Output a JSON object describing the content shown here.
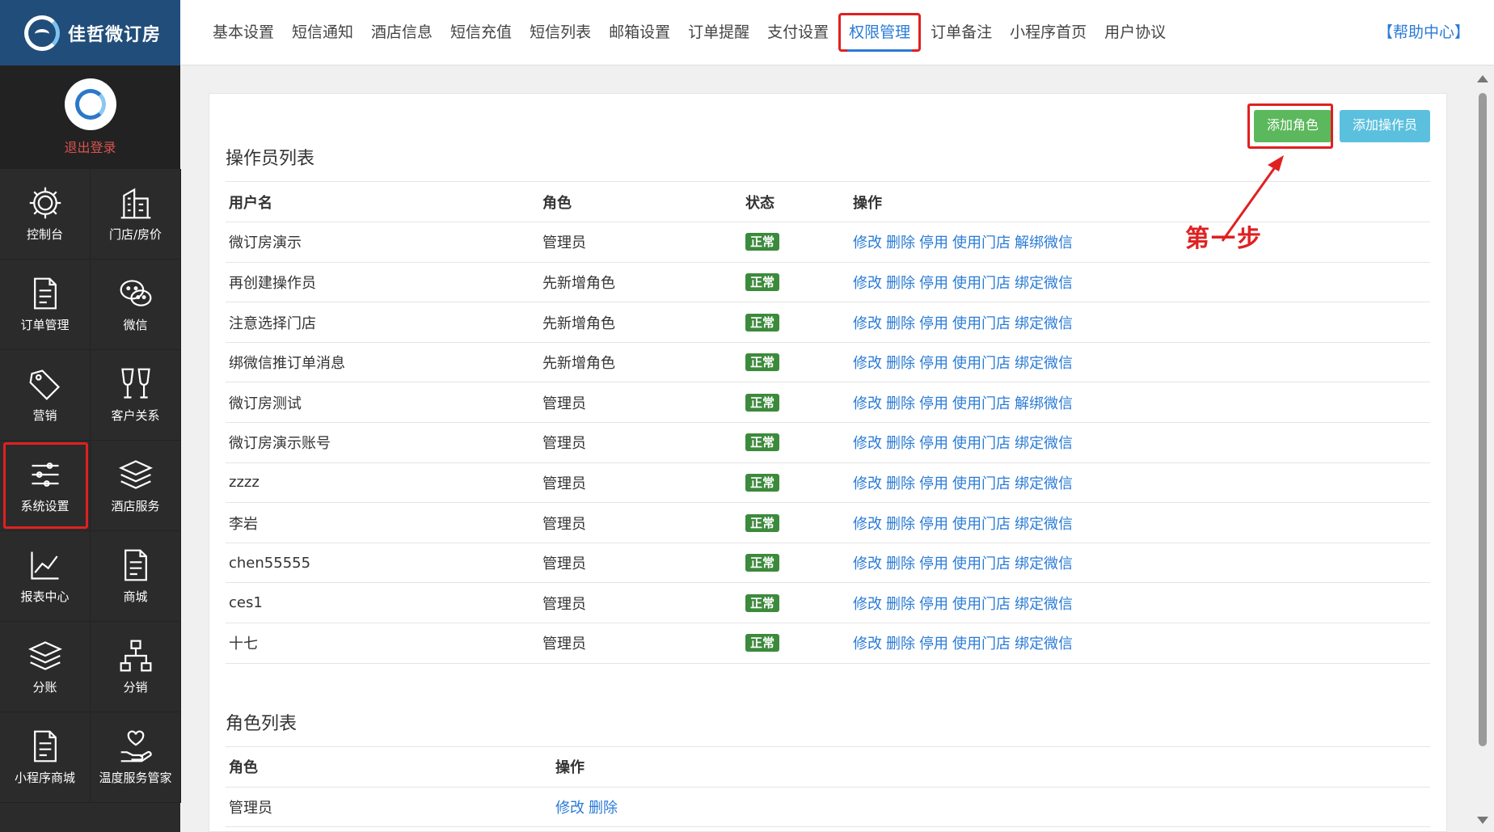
{
  "app": {
    "brand": "佳哲微订房",
    "logout": "退出登录"
  },
  "sidebar": {
    "items": [
      {
        "label": "控制台",
        "icon": "gear-icon"
      },
      {
        "label": "门店/房价",
        "icon": "building-icon"
      },
      {
        "label": "订单管理",
        "icon": "document-icon"
      },
      {
        "label": "微信",
        "icon": "wechat-icon"
      },
      {
        "label": "营销",
        "icon": "tag-icon"
      },
      {
        "label": "客户关系",
        "icon": "glasses-icon"
      },
      {
        "label": "系统设置",
        "icon": "sliders-icon"
      },
      {
        "label": "酒店服务",
        "icon": "layers-icon"
      },
      {
        "label": "报表中心",
        "icon": "chart-line-icon"
      },
      {
        "label": "商城",
        "icon": "document-icon"
      },
      {
        "label": "分账",
        "icon": "layers-icon"
      },
      {
        "label": "分销",
        "icon": "network-icon"
      },
      {
        "label": "小程序商城",
        "icon": "document-icon"
      },
      {
        "label": "温度服务管家",
        "icon": "heart-hand-icon"
      }
    ]
  },
  "tabs": [
    "基本设置",
    "短信通知",
    "酒店信息",
    "短信充值",
    "短信列表",
    "邮箱设置",
    "订单提醒",
    "支付设置",
    "权限管理",
    "订单备注",
    "小程序首页",
    "用户协议"
  ],
  "help": "【帮助中心】",
  "buttons": {
    "add_role": "添加角色",
    "add_operator": "添加操作员"
  },
  "annotation": {
    "step": "第一步"
  },
  "operators": {
    "title": "操作员列表",
    "headers": [
      "用户名",
      "角色",
      "状态",
      "操作"
    ],
    "rows": [
      {
        "name": "微订房演示",
        "role": "管理员",
        "status": "正常",
        "ops": [
          "修改",
          "删除",
          "停用",
          "使用门店",
          "解绑微信"
        ]
      },
      {
        "name": "再创建操作员",
        "role": "先新增角色",
        "status": "正常",
        "ops": [
          "修改",
          "删除",
          "停用",
          "使用门店",
          "绑定微信"
        ]
      },
      {
        "name": "注意选择门店",
        "role": "先新增角色",
        "status": "正常",
        "ops": [
          "修改",
          "删除",
          "停用",
          "使用门店",
          "绑定微信"
        ]
      },
      {
        "name": "绑微信推订单消息",
        "role": "先新增角色",
        "status": "正常",
        "ops": [
          "修改",
          "删除",
          "停用",
          "使用门店",
          "绑定微信"
        ]
      },
      {
        "name": "微订房测试",
        "role": "管理员",
        "status": "正常",
        "ops": [
          "修改",
          "删除",
          "停用",
          "使用门店",
          "解绑微信"
        ]
      },
      {
        "name": "微订房演示账号",
        "role": "管理员",
        "status": "正常",
        "ops": [
          "修改",
          "删除",
          "停用",
          "使用门店",
          "绑定微信"
        ]
      },
      {
        "name": "zzzz",
        "role": "管理员",
        "status": "正常",
        "ops": [
          "修改",
          "删除",
          "停用",
          "使用门店",
          "绑定微信"
        ]
      },
      {
        "name": "李岩",
        "role": "管理员",
        "status": "正常",
        "ops": [
          "修改",
          "删除",
          "停用",
          "使用门店",
          "绑定微信"
        ]
      },
      {
        "name": "chen55555",
        "role": "管理员",
        "status": "正常",
        "ops": [
          "修改",
          "删除",
          "停用",
          "使用门店",
          "绑定微信"
        ]
      },
      {
        "name": "ces1",
        "role": "管理员",
        "status": "正常",
        "ops": [
          "修改",
          "删除",
          "停用",
          "使用门店",
          "绑定微信"
        ]
      },
      {
        "name": "十七",
        "role": "管理员",
        "status": "正常",
        "ops": [
          "修改",
          "删除",
          "停用",
          "使用门店",
          "绑定微信"
        ]
      }
    ]
  },
  "roles": {
    "title": "角色列表",
    "headers": [
      "角色",
      "操作"
    ],
    "rows": [
      {
        "name": "管理员",
        "ops": [
          "修改",
          "删除"
        ]
      }
    ]
  },
  "colors": {
    "brand": "#214d7a",
    "accent": "#2a7bd6",
    "highlight": "#e02020",
    "green": "#5cb85c",
    "blue": "#5bc0de"
  }
}
